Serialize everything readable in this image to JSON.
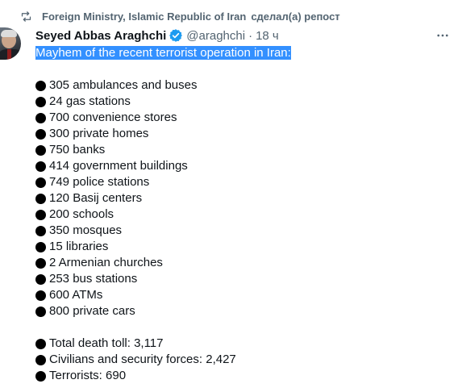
{
  "repost": {
    "icon": "repost-icon",
    "account": "Foreign Ministry, Islamic Republic of Iran",
    "suffix": "сделал(а) репост"
  },
  "author": {
    "name": "Seyed Abbas Araghchi",
    "handle": "@araghchi",
    "separator": "·",
    "time": "18 ч",
    "verified_icon": "verified-badge-icon",
    "verified_color": "#1d9bf0"
  },
  "more_icon": "more-horizontal-icon",
  "tweet": {
    "headline": "Mayhem of the recent terrorist operation in Iran:",
    "bullet_icon": "black-circle-icon",
    "items": [
      "305 ambulances and buses",
      "24 gas stations",
      "700 convenience stores",
      "300 private homes",
      "750 banks",
      "414 government buildings",
      "749 police stations",
      "120 Basij centers",
      "200 schools",
      "350 mosques",
      "15 libraries",
      "2 Armenian churches",
      "253 bus stations",
      "600 ATMs",
      "800 private cars"
    ],
    "totals": [
      "Total death toll: 3,117",
      "Civilians and security forces: 2,427",
      "Terrorists: 690"
    ]
  },
  "colors": {
    "text": "#0f1419",
    "secondary": "#536471",
    "selection": "#3390ff"
  }
}
